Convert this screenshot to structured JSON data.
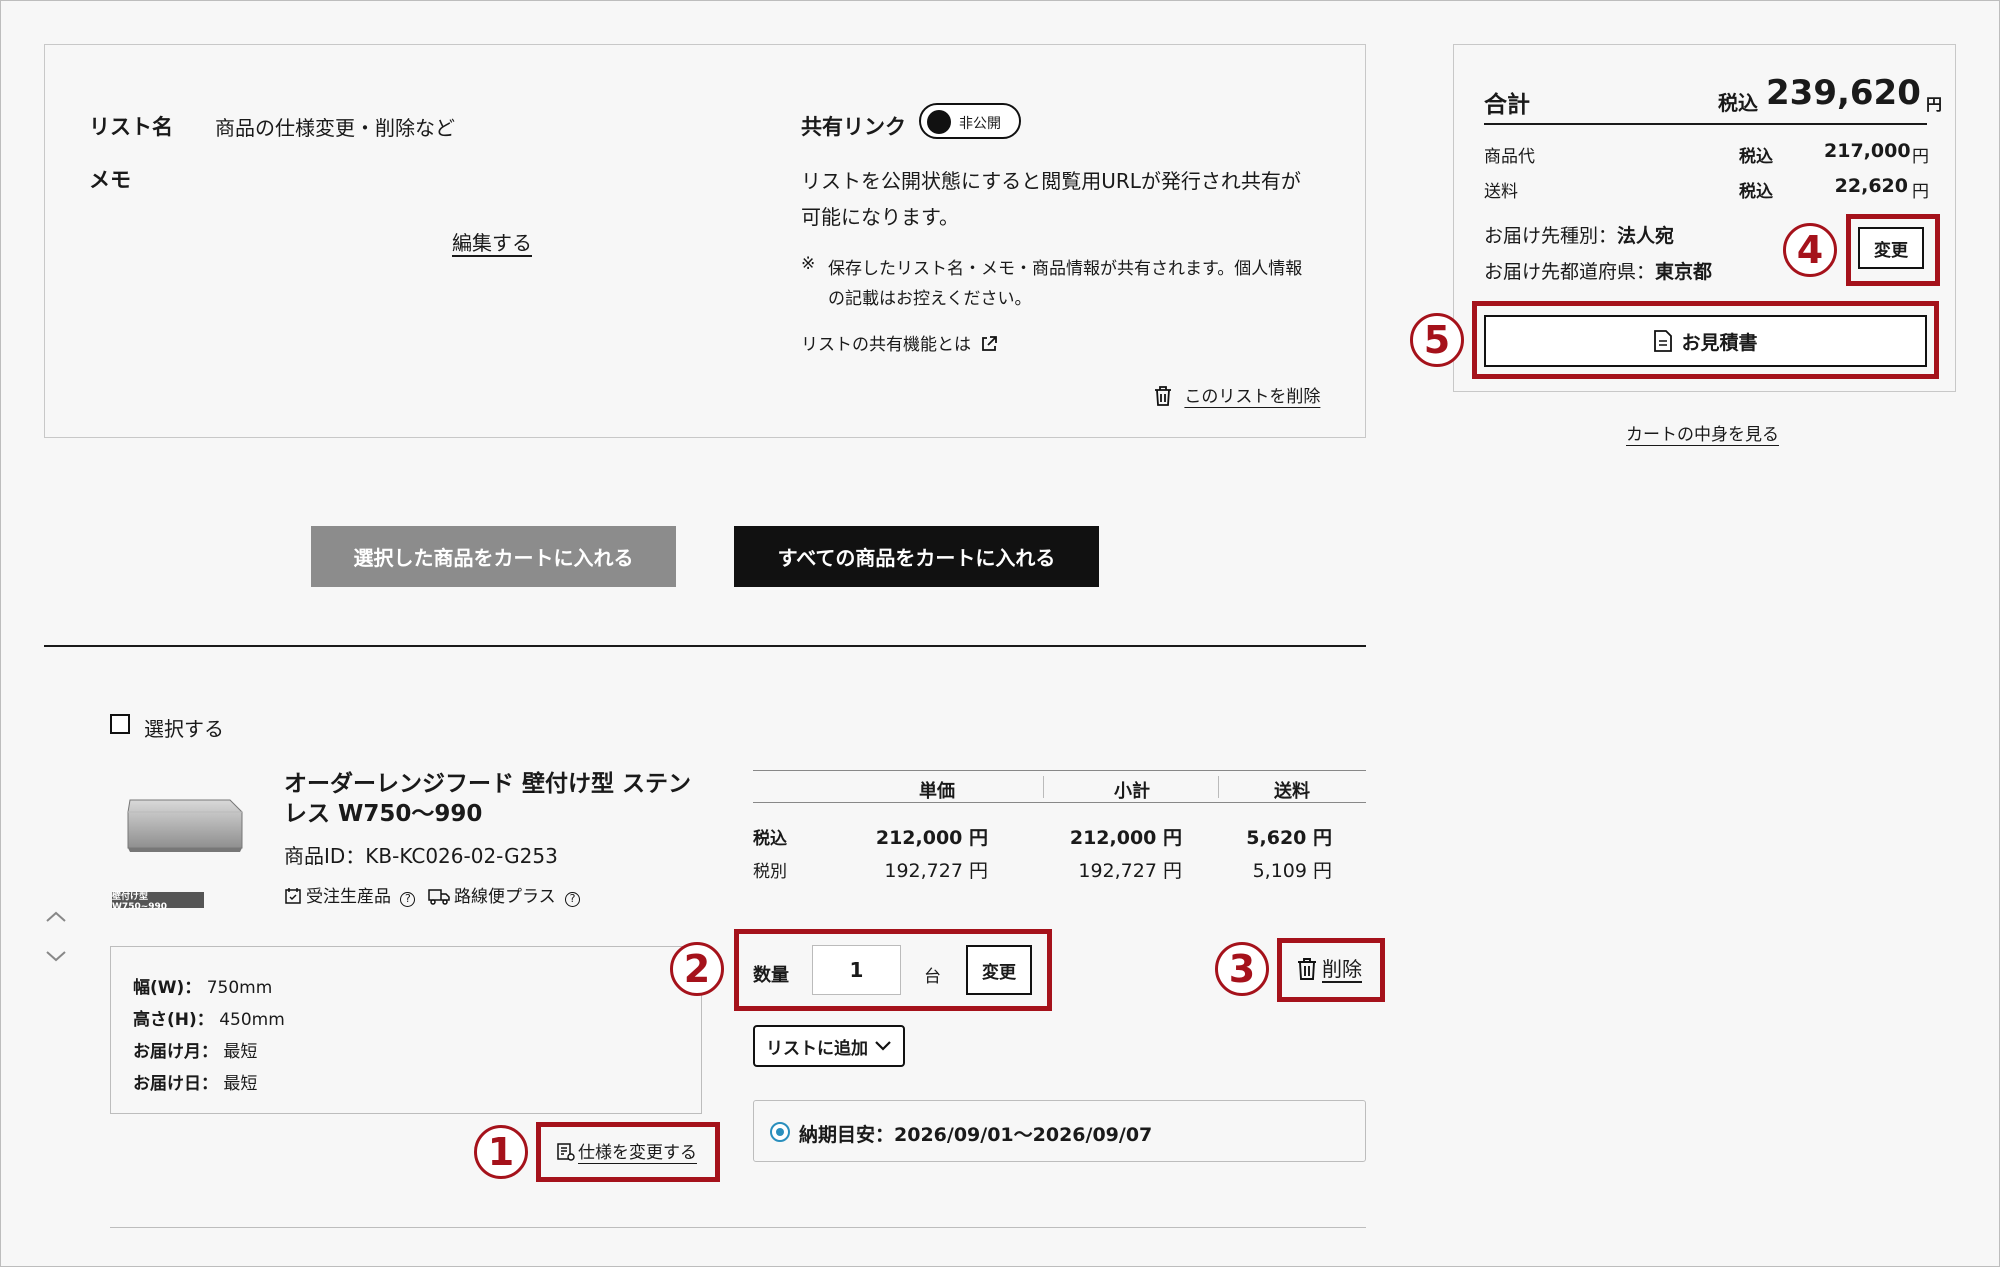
{
  "list_panel": {
    "list_name_label": "リスト名",
    "list_name_value": "商品の仕様変更・削除など",
    "memo_label": "メモ",
    "edit_link": "編集する",
    "share_label": "共有リンク",
    "share_toggle_text": "非公開",
    "share_desc_line1": "リストを公開状態にすると閲覧用URLが発行され共有が",
    "share_desc_line2": "可能になります。",
    "note_mark": "※",
    "note_line1": "保存したリスト名・メモ・商品情報が共有されます。個人情報",
    "note_line2": "の記載はお控えください。",
    "share_help_link": "リストの共有機能とは",
    "delete_list_link": "このリストを削除"
  },
  "summary": {
    "total_label": "合計",
    "total_tax_label": "税込",
    "total_value": "239,620",
    "total_unit": "円",
    "rows": [
      {
        "label": "商品代",
        "tax": "税込",
        "value": "217,000",
        "unit": "円"
      },
      {
        "label": "送料",
        "tax": "税込",
        "value": "22,620",
        "unit": "円"
      }
    ],
    "dest_type_label": "お届け先種別：",
    "dest_type_value": "法人宛",
    "dest_pref_label": "お届け先都道府県：",
    "dest_pref_value": "東京都",
    "change_button": "変更",
    "quote_button": "お見積書",
    "cart_link": "カートの中身を見る"
  },
  "actions": {
    "add_selected": "選択した商品をカートに入れる",
    "add_all": "すべての商品をカートに入れる"
  },
  "item": {
    "select_label": "選択する",
    "thumb_caption": "壁付け型 W750~990",
    "name_line1": "オーダーレンジフード 壁付け型 ステン",
    "name_line2": "レス W750〜990",
    "product_id": "商品ID：KB-KC026-02-G253",
    "badge1": "受注生産品",
    "badge2": "路線便プラス",
    "price_headers": [
      "単価",
      "小計",
      "送料"
    ],
    "tax_in_label": "税込",
    "tax_ex_label": "税別",
    "tax_in_values": [
      "212,000 円",
      "212,000 円",
      "5,620 円"
    ],
    "tax_ex_values": [
      "192,727 円",
      "192,727 円",
      "5,109 円"
    ],
    "specs": [
      {
        "label": "幅(W)：",
        "value": "750mm"
      },
      {
        "label": "高さ(H)：",
        "value": "450mm"
      },
      {
        "label": "お届け月：",
        "value": "最短"
      },
      {
        "label": "お届け日：",
        "value": "最短"
      }
    ],
    "change_spec_link": "仕様を変更する",
    "qty_label": "数量",
    "qty_value": "1",
    "qty_unit": "台",
    "qty_change": "変更",
    "add_to_list": "リストに追加",
    "delete_label": "削除",
    "delivery_estimate": "納期目安：2026/09/01〜2026/09/07"
  },
  "markers": [
    "1",
    "2",
    "3",
    "4",
    "5"
  ]
}
